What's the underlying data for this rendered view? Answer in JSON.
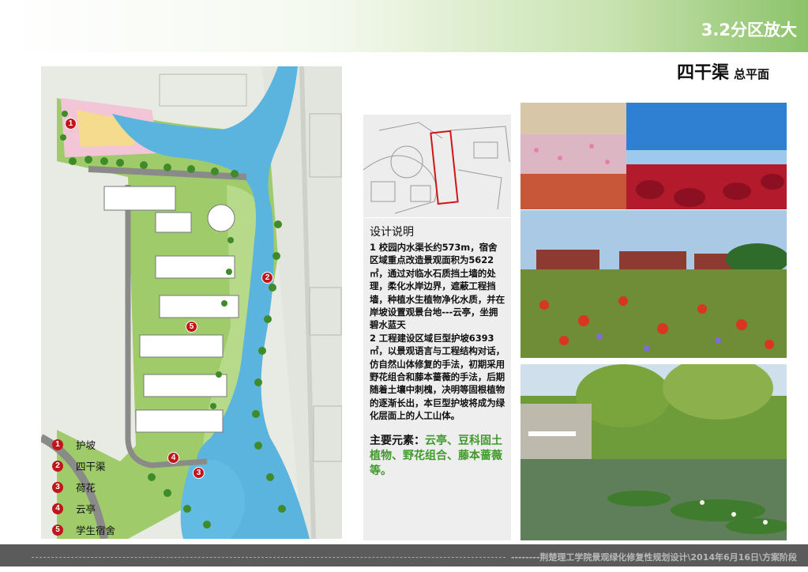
{
  "header": {
    "section_title": "3.2分区放大",
    "subtitle_main": "四干渠",
    "subtitle_sub": "总平面"
  },
  "site_plan": {
    "markers": [
      "1",
      "2",
      "3",
      "4",
      "5"
    ]
  },
  "legend": [
    {
      "num": "1",
      "label": "护坡"
    },
    {
      "num": "2",
      "label": "四干渠"
    },
    {
      "num": "3",
      "label": "荷花"
    },
    {
      "num": "4",
      "label": "云亭"
    },
    {
      "num": "5",
      "label": "学生宿舍"
    }
  ],
  "description": {
    "heading": "设计说明",
    "body": "1 校园内水渠长约573m，宿舍区域重点改造景观面积为5622㎡，通过对临水石质挡土墙的处理，柔化水岸边界，遮蔽工程挡墙，种植水生植物净化水质，并在岸坡设置观景台地---云亭，坐拥碧水蓝天\n2 工程建设区域巨型护坡6393㎡，以景观语言与工程结构对话，仿自然山体修复的手法，初期采用野花组合和藤本蔷薇的手法，后期随着土壤中刺槐，决明等固根植物的逐渐长出，本巨型护坡将成为绿化层面上的人工山体。",
    "main_elements_label": "主要元素：",
    "main_elements_value": "云亭、豆科固土植物、野花组合、藤本蔷薇等。"
  },
  "footer": {
    "text": "--------荆楚理工学院景观绿化修复性规划设计\\2014年6月16日\\方案阶段"
  },
  "colors": {
    "header_green": "#8cc36a",
    "marker_red": "#c0161b",
    "highlight_green": "#3f9a2b",
    "footer_gray": "#5b5b5b",
    "water_blue": "#5ab4de"
  }
}
